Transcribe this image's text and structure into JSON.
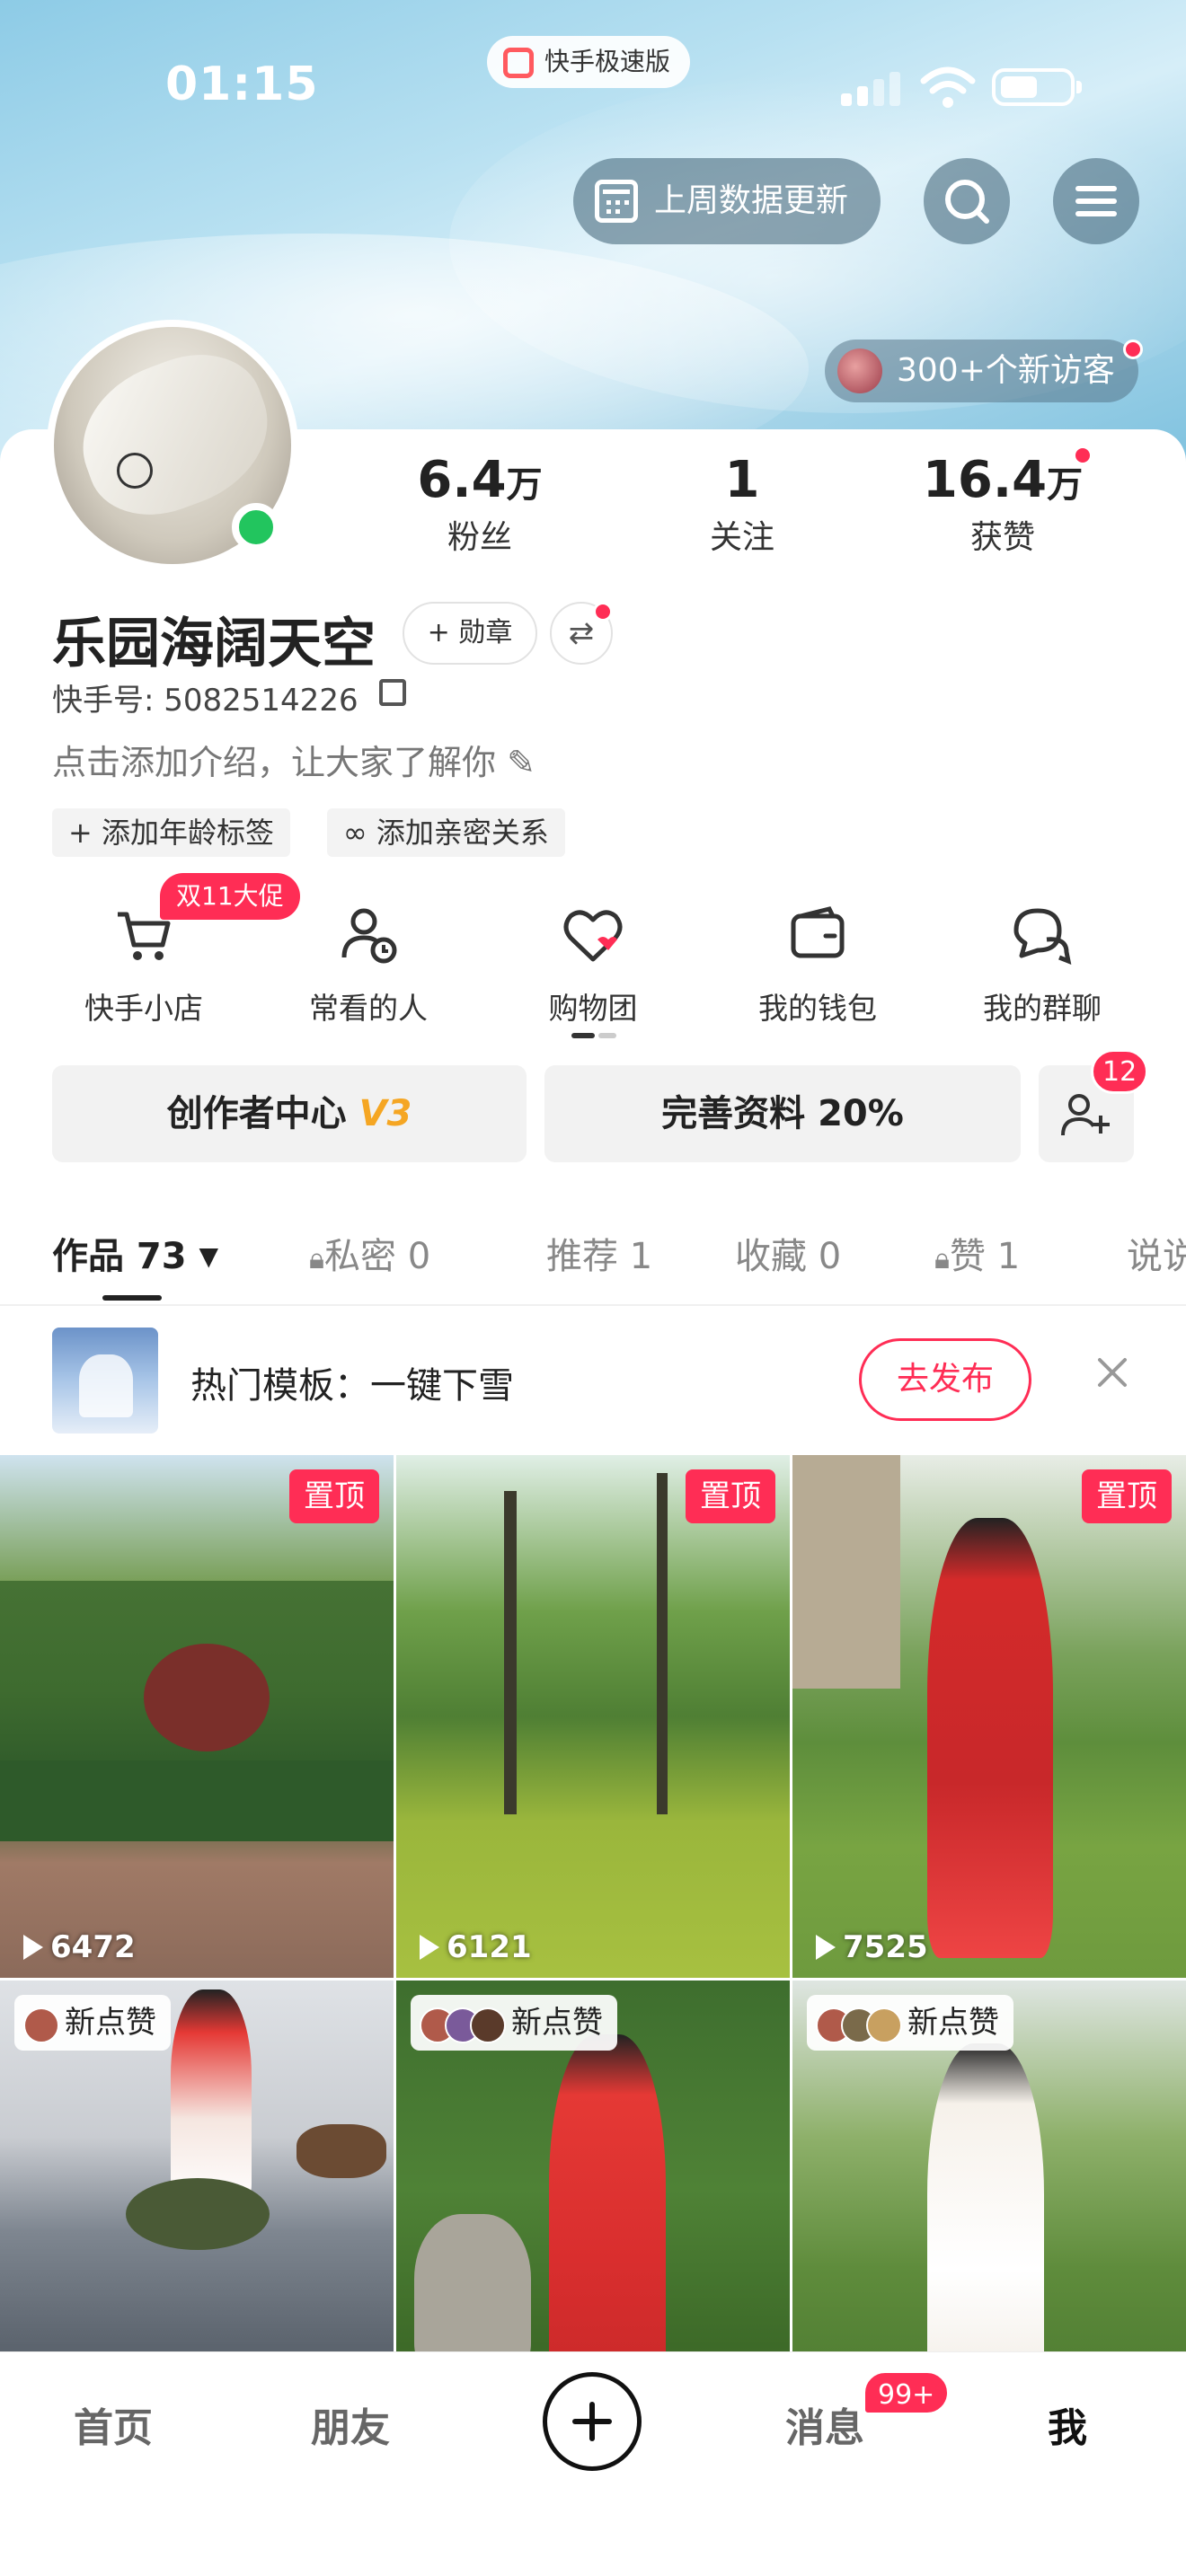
{
  "status_bar": {
    "time": "01:15",
    "app_pill": "快手极速版"
  },
  "header": {
    "data_update_label": "上周数据更新",
    "visitors_label": "300+个新访客"
  },
  "profile": {
    "stats": [
      {
        "num": "6.4",
        "unit": "万",
        "label": "粉丝"
      },
      {
        "num": "1",
        "unit": "",
        "label": "关注"
      },
      {
        "num": "16.4",
        "unit": "万",
        "label": "获赞"
      }
    ],
    "name": "乐园海阔天空",
    "medal_label": "+ 勋章",
    "kuaishou_id": "快手号: 5082514226",
    "intro": "点击添加介绍，让大家了解你",
    "tags": [
      "+ 添加年龄标签",
      "添加亲密关系"
    ]
  },
  "shortcuts": [
    {
      "label": "快手小店",
      "icon": "cart-icon"
    },
    {
      "label": "常看的人",
      "icon": "user-clock-icon"
    },
    {
      "label": "购物团",
      "icon": "heart-chat-icon"
    },
    {
      "label": "我的钱包",
      "icon": "wallet-icon"
    },
    {
      "label": "我的群聊",
      "icon": "group-chat-icon"
    }
  ],
  "promo_badge": "双11大促",
  "actions": {
    "creator_center": "创作者中心",
    "creator_level": "V3",
    "complete_profile": "完善资料 20%",
    "add_friend_badge": "12"
  },
  "tabs": [
    "作品 73",
    "私密 0",
    "推荐 1",
    "收藏 0",
    "赞 1",
    "说说"
  ],
  "template_banner": {
    "text": "热门模板：一键下雪",
    "publish_label": "去发布"
  },
  "videos": [
    {
      "pinned": "置顶",
      "plays": "6472"
    },
    {
      "pinned": "置顶",
      "plays": "6121"
    },
    {
      "pinned": "置顶",
      "plays": "7525"
    },
    {
      "new_like": "新点赞"
    },
    {
      "new_like": "新点赞"
    },
    {
      "new_like": "新点赞"
    }
  ],
  "bottom_nav": {
    "home": "首页",
    "friends": "朋友",
    "messages": "消息",
    "messages_badge": "99+",
    "me": "我"
  },
  "colors": {
    "accent": "#ff2d55",
    "online": "#22c55e",
    "creator_level": "#f5a623"
  }
}
